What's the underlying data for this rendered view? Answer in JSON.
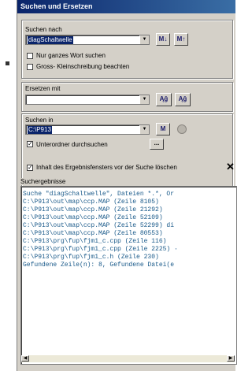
{
  "window": {
    "title": "Suchen und Ersetzen"
  },
  "search": {
    "label": "Suchen nach",
    "value": "diagSchaltwelle",
    "whole_word_label": "Nur ganzes Wort suchen",
    "case_label": "Gross- Kleinschreibung beachten"
  },
  "replace": {
    "label": "Ersetzen mit",
    "value": ""
  },
  "search_in": {
    "label": "Suchen in",
    "value": "C:\\P913",
    "subfolders_label": "Unterordner durchsuchen",
    "browse_label": "...",
    "clear_label": "Inhalt des Ergebnisfensters vor der Suche löschen"
  },
  "results": {
    "label": "Suchergebnisse",
    "lines": [
      "Suche \"diagSchaltwelle\", Dateien *.*, Or",
      "C:\\P913\\out\\map\\ccp.MAP (Zeile 8105)",
      "C:\\P913\\out\\map\\ccp.MAP (Zeile 21292)",
      "C:\\P913\\out\\map\\ccp.MAP (Zeile 52109)",
      "C:\\P913\\out\\map\\ccp.MAP (Zeile 52299) di",
      "C:\\P913\\out\\map\\ccp.MAP (Zeile 80553)",
      "C:\\P913\\prg\\fup\\fjm1_c.cpp (Zeile 116)",
      "C:\\P913\\prg\\fup\\fjm1_c.cpp (Zeile 2225) ·",
      "C:\\P913\\prg\\fup\\fjm1_c.h (Zeile 230)",
      "Gefundene Zeile(n): 8, Gefundene Datei(e"
    ]
  },
  "icons": {
    "find_down": "binoculars-down-icon",
    "find_up": "binoculars-up-icon",
    "replace": "replace-icon",
    "replace_all": "replace-all-icon",
    "find_in_files": "binoculars-icon",
    "stop": "stop-icon",
    "close": "close-icon"
  }
}
